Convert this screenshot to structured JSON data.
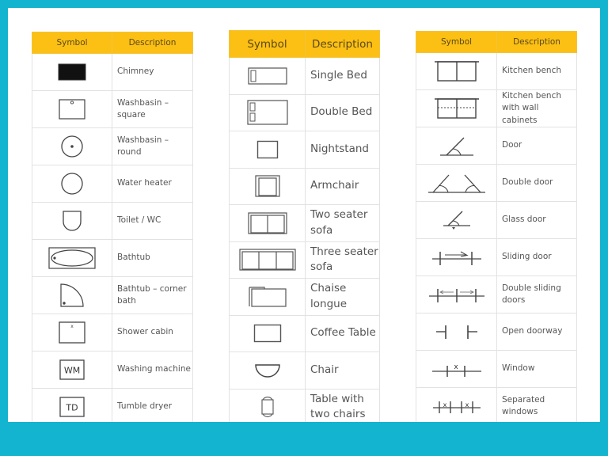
{
  "frame_color": "#12b4cf",
  "header_color": "#fcbf14",
  "tables": [
    {
      "header": {
        "symbol": "Symbol",
        "description": "Description"
      },
      "rows": [
        {
          "icon": "chimney-icon",
          "label": "Chimney"
        },
        {
          "icon": "washbasin-square-icon",
          "label": "Washbasin – square"
        },
        {
          "icon": "washbasin-round-icon",
          "label": "Washbasin – round"
        },
        {
          "icon": "water-heater-icon",
          "label": "Water heater"
        },
        {
          "icon": "toilet-icon",
          "label": "Toilet / WC"
        },
        {
          "icon": "bathtub-icon",
          "label": "Bathtub"
        },
        {
          "icon": "corner-bath-icon",
          "label": "Bathtub – corner bath"
        },
        {
          "icon": "shower-cabin-icon",
          "label": "Shower cabin"
        },
        {
          "icon": "washing-machine-icon",
          "label": "Washing machine",
          "icon_text": "WM"
        },
        {
          "icon": "tumble-dryer-icon",
          "label": "Tumble dryer",
          "icon_text": "TD"
        }
      ]
    },
    {
      "header": {
        "symbol": "Symbol",
        "description": "Description"
      },
      "rows": [
        {
          "icon": "single-bed-icon",
          "label": "Single Bed"
        },
        {
          "icon": "double-bed-icon",
          "label": "Double Bed"
        },
        {
          "icon": "nightstand-icon",
          "label": "Nightstand"
        },
        {
          "icon": "armchair-icon",
          "label": "Armchair"
        },
        {
          "icon": "two-seater-sofa-icon",
          "label": "Two seater sofa"
        },
        {
          "icon": "three-seater-sofa-icon",
          "label": "Three seater sofa"
        },
        {
          "icon": "chaise-longue-icon",
          "label": "Chaise longue"
        },
        {
          "icon": "coffee-table-icon",
          "label": "Coffee Table"
        },
        {
          "icon": "chair-icon",
          "label": "Chair"
        },
        {
          "icon": "table-two-chairs-icon",
          "label": "Table with two chairs"
        }
      ]
    },
    {
      "header": {
        "symbol": "Symbol",
        "description": "Description"
      },
      "rows": [
        {
          "icon": "kitchen-bench-icon",
          "label": "Kitchen bench"
        },
        {
          "icon": "kitchen-bench-cabinets-icon",
          "label": "Kitchen bench with wall cabinets"
        },
        {
          "icon": "door-icon",
          "label": "Door"
        },
        {
          "icon": "double-door-icon",
          "label": "Double door"
        },
        {
          "icon": "glass-door-icon",
          "label": "Glass door"
        },
        {
          "icon": "sliding-door-icon",
          "label": "Sliding door"
        },
        {
          "icon": "double-sliding-doors-icon",
          "label": "Double sliding doors"
        },
        {
          "icon": "open-doorway-icon",
          "label": "Open doorway"
        },
        {
          "icon": "window-icon",
          "label": "Window",
          "icon_text": "x"
        },
        {
          "icon": "separated-windows-icon",
          "label": "Separated windows",
          "icon_text": "x"
        }
      ]
    }
  ]
}
